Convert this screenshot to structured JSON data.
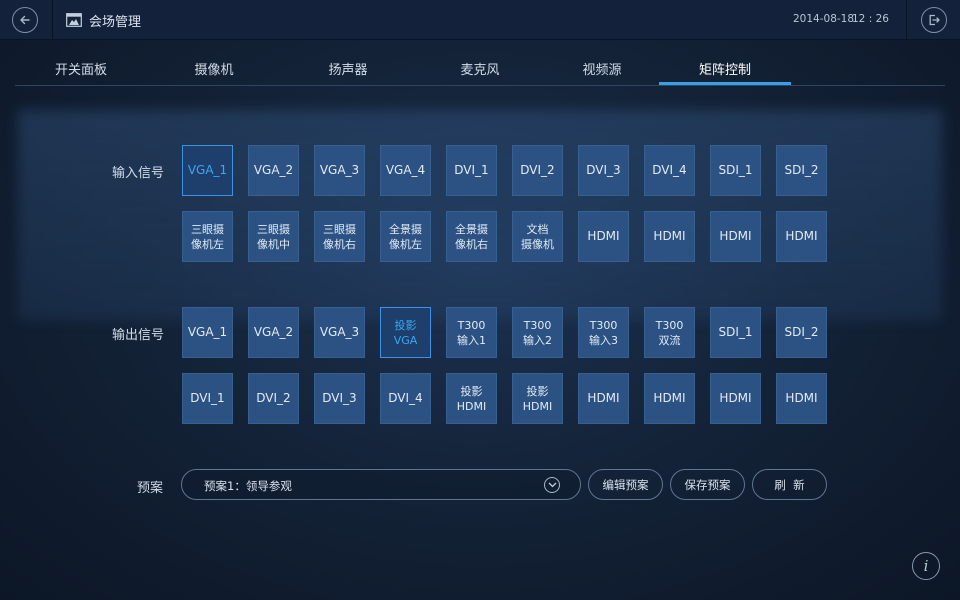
{
  "header": {
    "title": "会场管理",
    "date": "2014-08-18",
    "time": "12 : 26",
    "back_icon": "back-arrow-icon",
    "exit_icon": "exit-icon"
  },
  "tabs": [
    {
      "label": "开关面板",
      "active": false
    },
    {
      "label": "摄像机",
      "active": false
    },
    {
      "label": "扬声器",
      "active": false
    },
    {
      "label": "麦克风",
      "active": false
    },
    {
      "label": "视频源",
      "active": false
    },
    {
      "label": "矩阵控制",
      "active": true
    }
  ],
  "input_signal": {
    "label": "输入信号",
    "row1": [
      "VGA_1",
      "VGA_2",
      "VGA_3",
      "VGA_4",
      "DVI_1",
      "DVI_2",
      "DVI_3",
      "DVI_4",
      "SDI_1",
      "SDI_2"
    ],
    "row2": [
      "三眼摄\n像机左",
      "三眼摄\n像机中",
      "三眼摄\n像机右",
      "全景摄\n像机左",
      "全景摄\n像机右",
      "文档\n摄像机",
      "HDMI",
      "HDMI",
      "HDMI",
      "HDMI"
    ],
    "selected": "VGA_1"
  },
  "output_signal": {
    "label": "输出信号",
    "row1": [
      "VGA_1",
      "VGA_2",
      "VGA_3",
      "投影\nVGA",
      "T300\n输入1",
      "T300\n输入2",
      "T300\n输入3",
      "T300\n双流",
      "SDI_1",
      "SDI_2"
    ],
    "row2": [
      "DVI_1",
      "DVI_2",
      "DVI_3",
      "DVI_4",
      "投影\nHDMI",
      "投影\nHDMI",
      "HDMI",
      "HDMI",
      "HDMI",
      "HDMI"
    ],
    "selected": "投影\nVGA"
  },
  "preset": {
    "label": "预案",
    "value": "预案1：领导参观",
    "edit_label": "编辑预案",
    "save_label": "保存预案",
    "refresh_label": "刷  新"
  },
  "colors": {
    "accent": "#3aa0e6",
    "button_bg": "#2b5283",
    "background": "#142338"
  }
}
